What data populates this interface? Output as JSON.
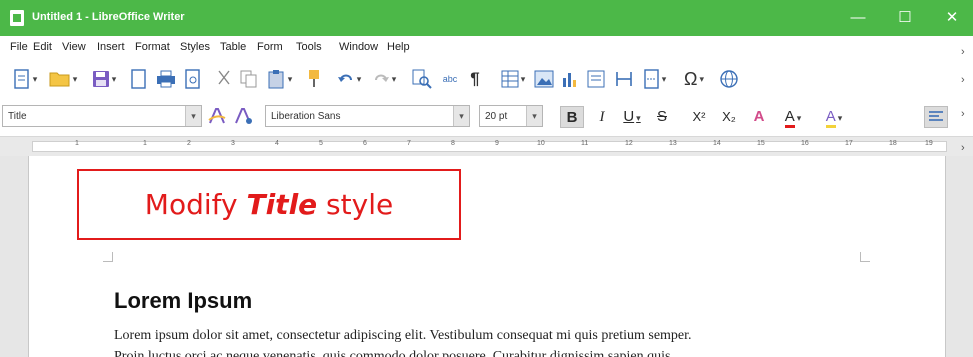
{
  "window": {
    "title": "Untitled 1 - LibreOffice Writer",
    "minimize_glyph": "—",
    "maximize_glyph": "☐",
    "close_glyph": "✕"
  },
  "menu": [
    "File",
    "Edit",
    "View",
    "Insert",
    "Format",
    "Styles",
    "Table",
    "Form",
    "Tools",
    "Window",
    "Help"
  ],
  "toolbar": {
    "icons": [
      "new-document-icon",
      "open-folder-icon",
      "save-icon",
      "export-pdf-icon",
      "print-icon",
      "print-preview-icon",
      "cut-icon",
      "copy-icon",
      "paste-icon",
      "clone-formatting-icon",
      "undo-icon",
      "redo-icon",
      "find-replace-icon",
      "spelling-icon",
      "formatting-marks-icon",
      "insert-table-icon",
      "insert-image-icon",
      "insert-chart-icon",
      "insert-textbox-icon",
      "insert-field-icon",
      "page-break-icon",
      "special-character-icon",
      "hyperlink-icon"
    ],
    "spelling_label": "abc",
    "special_char_glyph": "Ω",
    "pilcrow_glyph": "¶"
  },
  "formatting": {
    "paragraph_style": "Title",
    "font_name": "Liberation Sans",
    "font_size": "20 pt",
    "bold": "B",
    "italic": "I",
    "underline": "U",
    "strike": "S",
    "superscript": "X²",
    "subscript": "X₂",
    "font_color_label": "A",
    "highlight_label": "A",
    "dropdown_glyph": "▾"
  },
  "ruler": {
    "ticks": [
      "1",
      "1",
      "2",
      "3",
      "4",
      "5",
      "6",
      "7",
      "8",
      "9",
      "10",
      "11",
      "12",
      "13",
      "14",
      "15",
      "16",
      "17",
      "18",
      "19"
    ]
  },
  "annotation": {
    "prefix": "Modify ",
    "emphasis": "Title",
    "suffix": " style",
    "color": "#e21b1b"
  },
  "document": {
    "heading": "Lorem Ipsum",
    "body_line1": "Lorem ipsum dolor sit amet, consectetur adipiscing elit. Vestibulum consequat mi quis pretium semper.",
    "body_line2": "Proin luctus orci ac neque venenatis, quis commodo dolor posuere. Curabitur dignissim sapien quis"
  },
  "colors": {
    "titlebar": "#4cb848",
    "accent_red": "#e21b1b",
    "icon_blue": "#3b6fb6"
  }
}
